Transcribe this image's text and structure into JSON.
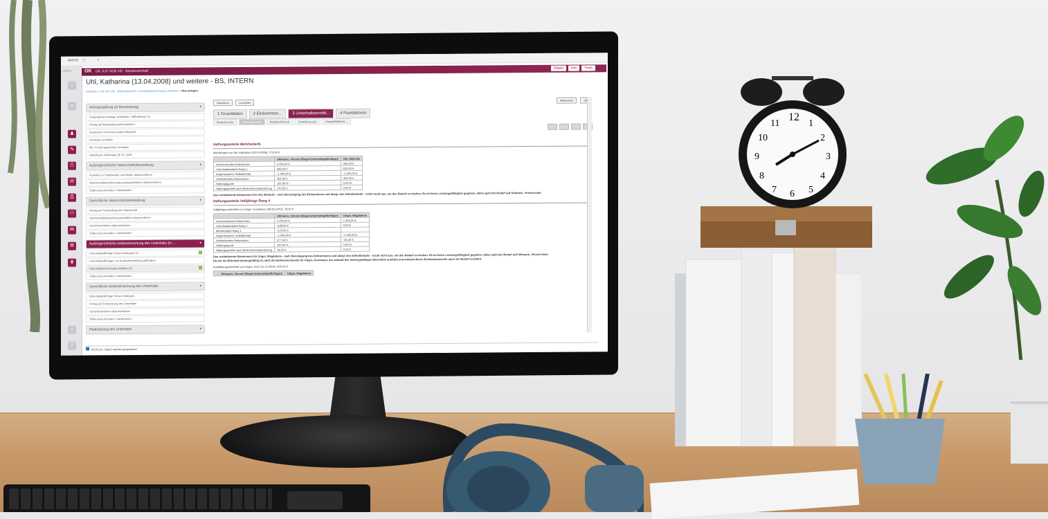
{
  "window": {
    "title": "ANVIS",
    "controls": "– □ ×"
  },
  "app": {
    "logo": "OK",
    "bar_title": "OK.JUS SGB VIII · Beistandschaft",
    "buttons": [
      "Objekt",
      "Info",
      "Tools"
    ]
  },
  "rail": {
    "logo": "ANVIS"
  },
  "page": {
    "title": "Uhl, Katharina (13.04.2008) und weitere - BS, INTERN",
    "breadcrumb": "Infoleiste » OK.JUS VIII · Beistandschaft » Unterhaltsberechnung verwalten »",
    "breadcrumb_current": "Neu anlegen"
  },
  "sections": [
    {
      "title": "Antragsstellung (in Bearbeitung)",
      "active": false,
      "items": [
        "Vorgangsvorschlaege bearbeiten: Hilfeartbeitz (1)",
        "Antrag auf Beistandschaft bearbeiten",
        "Gespraech mit betreuendem Elternteil",
        "Antraege verwalten",
        "BS, Pruefungstermine verwalten",
        "Statistische Merkmale §§ 76, 5/4/9"
      ]
    },
    {
      "title": "Außergerichtliche Vaterschaftsfeststellung",
      "active": false,
      "items": [
        "Kontakte zu Putativvater und Mutter dokumentieren",
        "Vaterschaftsanerkennung aussergerichtlich dokumentieren",
        "Teilprozess beenden / wiederholen"
      ]
    },
    {
      "title": "Gerichtliche Vaterschaftsfeststellung",
      "active": false,
      "items": [
        "Antrag auf Feststellung der Vaterschaft",
        "Vaterschaftsfeststellung gerichtlich dokumentieren",
        "Gerichtsverfahren dokumentieren",
        "Teilprozess beenden / wiederholen"
      ]
    },
    {
      "title": "Außergerichtliche Geltendmachung des Unterhalts (In ...",
      "active": true,
      "items": [
        "Unterhaltspflichtige Person festlegen (1)",
        "Unterhaltspflichtigen zur Auskunftserteilung auffordern",
        "Unterhaltsberechnung erstellen (1)",
        "Teilprozess beenden / wiederholen"
      ]
    },
    {
      "title": "Gerichtliche Geltendmachung des Unterhalts",
      "active": false,
      "items": [
        "Unterhaltspflichtige Person festlegen",
        "Antrag auf Festsetzung des Unterhalts",
        "Gerichtsverfahren dokumentieren",
        "Teilprozess beenden / wiederholen"
      ]
    },
    {
      "title": "Realisierung des Unterhalts",
      "active": false,
      "items": []
    }
  ],
  "content": {
    "top_buttons": [
      "Speichern",
      "Loeschen"
    ],
    "top_right": [
      "Abbrechen",
      "OK"
    ],
    "tabs": [
      "1 Grunddaten",
      "2 Einkommen...",
      "3 Unterhaltsermittl...",
      "4 Fluefaktoren"
    ],
    "subtabs": [
      "Bedarfs-Ordn.",
      "Haftungsanteile",
      "Bedarfs-Erhoeh.",
      "Verteilung Leis.",
      "Mangelfallberec..."
    ],
    "h1": "Haftungsanteile Mehrbedarfe",
    "p1": "Mehrbedarf von Uhl, Katharina (13.04.2008): 170,00 €",
    "table1_head": [
      "",
      "Uhlmann, Vincent (Regel-Unterhaltspflichtiger)",
      "Uhl, Michelle"
    ],
    "table1_rows": [
      [
        "Verrechnendes Einkommen",
        "2.000,00 €",
        "994,00 €"
      ],
      [
        "Unterhaltsbedarfe Rang 1",
        "638,00 €",
        "530,00 €"
      ],
      [
        "Angemessener Selbstbehalt",
        "-1.400,00 €",
        "-1.400,00 €"
      ],
      [
        "Verbleibendes Einkommen",
        "452,00 €",
        "452,00 €"
      ],
      [
        "Haftungsquote",
        "100,00 %",
        "0,00 %"
      ],
      [
        "Haftungsanteile nach Einkommensaenderung",
        "170,00 €",
        "0,00 €"
      ]
    ],
    "p2": "Das verbleibende Einkommen für Uhl, Michelle - nach Bereinigung des Einkommens und abzgl. des Selbstbehalts - reicht nicht aus, um den Bedarf zu decken. Es ist keine Leistungsfähigkeit gegeben, daher geht der Bedarf auf Uhlmann, Vincent über.",
    "h2": "Haftungsanteile Volljährige Rang 4",
    "p3": "Volljährigenunterhalt von Unger, Konstanze (08.05.2001): 78,00 €",
    "table2_head": [
      "",
      "Uhlmann, Vincent (Regel-Unterhaltspflichtiger)",
      "Unger, Magdalena"
    ],
    "table2_rows": [
      [
        "Anrechenbares Einkommen",
        "2.000,00 €",
        "1.353,00 €"
      ],
      [
        "Unterhaltsbedarfe Rang 1",
        "-638,00 €",
        "0,00 €"
      ],
      [
        "Mehrbedarfe Rang 1",
        "-170,00 €",
        ""
      ],
      [
        "Angemessener Selbstbehalt",
        "-1.400,00 €",
        "-1.400,00 €"
      ],
      [
        "Verbleibendes Einkommen",
        "377,00 €",
        "-46,42 €"
      ],
      [
        "Haftungsquote",
        "100,00 %",
        "0,00 %"
      ],
      [
        "Haftungsanteile nach Einkommensaenderung",
        "78,00 €",
        "0,00 €"
      ]
    ],
    "p4": "Das verbleibende Einkommen für Unger, Magdalena - nach Bereinigung des Einkommens und abzgl. des Selbstbehalts - reicht nicht aus, um den Bedarf zu decken. Es ist keine Leistungsfähigkeit gegeben, daher geht der Bedarf auf Uhlmann, Vincent über.",
    "p5": "Da nur ein Elternteil leistungsfähig ist, wird die Einkommensseite für Unger, Konstanze nur anhand des leistungsfähigen Elternteils ermittelt und anhand dieser Einkommensseite auch der Bedarf ermittelt.",
    "p6": "Ausbildungsunterhalt von Unger, Kurt (12.12.2002): 400,00 €",
    "table3_head": [
      "",
      "Uhlmann, Vincent (Regel-Unterhaltspflichtiger)",
      "Unger, Magdalena"
    ]
  },
  "status": {
    "text": "09:03:16 - Daten wurden gespeichert."
  },
  "clock": {
    "numerals": [
      "12",
      "1",
      "2",
      "3",
      "4",
      "5",
      "6",
      "7",
      "8",
      "9",
      "10",
      "11"
    ]
  },
  "colors": {
    "brand": "#8b214e",
    "check": "#8bbf3c",
    "desk": "#c89a6b",
    "wall": "#ececed"
  }
}
